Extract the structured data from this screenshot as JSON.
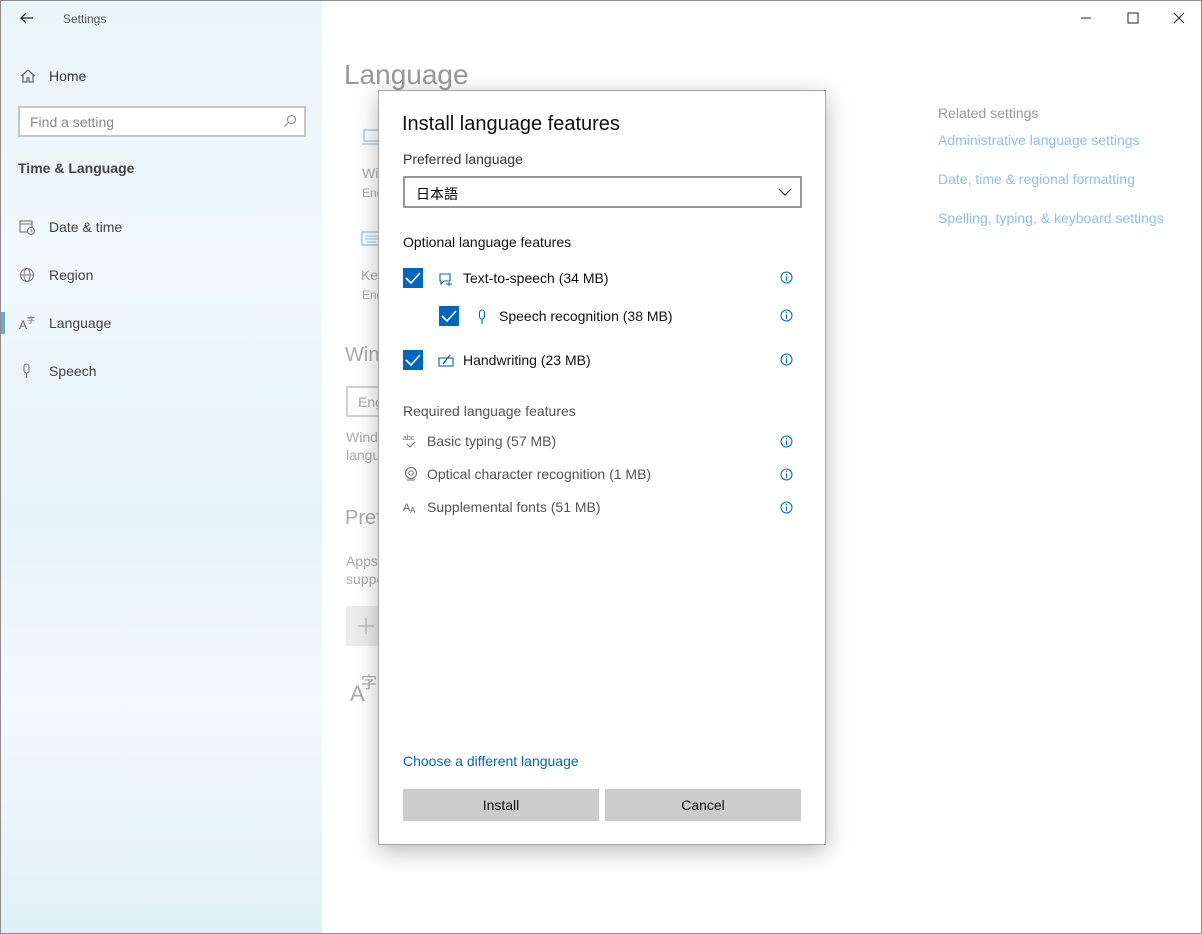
{
  "window": {
    "app_title": "Settings",
    "controls": [
      "minimize-icon",
      "maximize-icon",
      "close-icon"
    ]
  },
  "sidebar": {
    "home_label": "Home",
    "search_placeholder": "Find a setting",
    "section_title": "Time & Language",
    "items": [
      {
        "label": "Date & time",
        "icon": "calendar-clock-icon",
        "selected": false
      },
      {
        "label": "Region",
        "icon": "globe-icon",
        "selected": false
      },
      {
        "label": "Language",
        "icon": "language-icon",
        "selected": true
      },
      {
        "label": "Speech",
        "icon": "microphone-icon",
        "selected": false
      }
    ]
  },
  "main": {
    "page_title": "Language",
    "bg_fragments": {
      "wi": "Wi",
      "eng1": "Eng",
      "key": "Key",
      "eng2": "Eng",
      "win": "Win",
      "eng_input": "Eng",
      "wind": "Wind",
      "langu": "langu",
      "pref": "Pref",
      "apps": "Apps",
      "suppo": "suppo",
      "a_char": "A",
      "ji_char": "字"
    },
    "related": {
      "heading": "Related settings",
      "links": [
        "Administrative language settings",
        "Date, time & regional formatting",
        "Spelling, typing, & keyboard settings"
      ]
    }
  },
  "dialog": {
    "title": "Install language features",
    "preferred_label": "Preferred language",
    "preferred_value": "日本語",
    "optional_heading": "Optional language features",
    "optional_features": [
      {
        "label": "Text-to-speech (34 MB)",
        "checked": true,
        "icon": "text-to-speech-icon"
      },
      {
        "label": "Speech recognition (38 MB)",
        "checked": true,
        "icon": "microphone-icon"
      },
      {
        "label": "Handwriting (23 MB)",
        "checked": true,
        "icon": "handwriting-icon"
      }
    ],
    "required_heading": "Required language features",
    "required_features": [
      {
        "label": "Basic typing (57 MB)",
        "icon": "spellcheck-icon"
      },
      {
        "label": "Optical character recognition (1 MB)",
        "icon": "camera-icon"
      },
      {
        "label": "Supplemental fonts (51 MB)",
        "icon": "fonts-icon"
      }
    ],
    "choose_link": "Choose a different language",
    "install_label": "Install",
    "cancel_label": "Cancel"
  },
  "colors": {
    "accent": "#0067c0",
    "link_faded": "#8cc2e6",
    "button_gray": "#cccccc"
  }
}
